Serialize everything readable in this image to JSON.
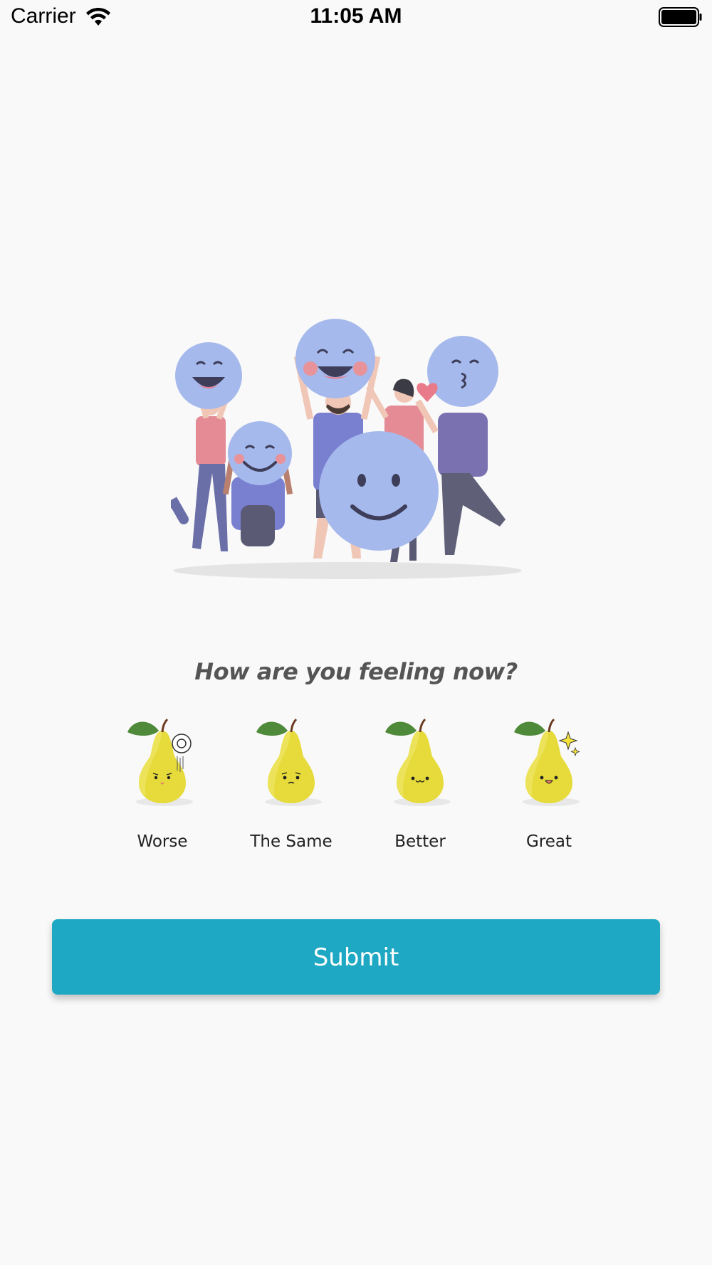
{
  "status_bar": {
    "carrier": "Carrier",
    "time": "11:05 AM"
  },
  "survey": {
    "question": "How are you feeling now?",
    "options": [
      {
        "label": "Worse",
        "icon": "pear-worse-icon"
      },
      {
        "label": "The Same",
        "icon": "pear-same-icon"
      },
      {
        "label": "Better",
        "icon": "pear-better-icon"
      },
      {
        "label": "Great",
        "icon": "pear-great-icon"
      }
    ],
    "submit_label": "Submit"
  },
  "colors": {
    "accent": "#1fa8c3",
    "background": "#f9f9f9",
    "illustration_blue": "#a6b9ec"
  }
}
